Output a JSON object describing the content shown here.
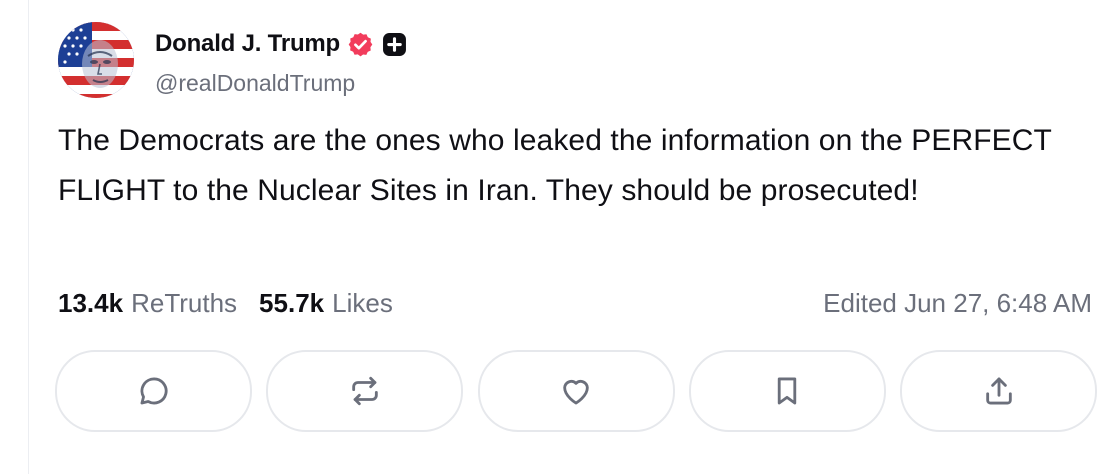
{
  "author": {
    "display_name": "Donald J. Trump",
    "handle": "@realDonaldTrump",
    "verified_icon": "verified-badge-icon",
    "plus_icon": "plus-badge-icon",
    "verified_color": "#f23c5c"
  },
  "post": {
    "text": "The Democrats are the ones who leaked the information on the PERFECT FLIGHT to the Nuclear Sites in Iran. They should be prosecuted!"
  },
  "stats": {
    "retruths_count": "13.4k",
    "retruths_label": "ReTruths",
    "likes_count": "55.7k",
    "likes_label": "Likes",
    "edited": "Edited Jun 27, 6:48 AM"
  },
  "actions": [
    {
      "icon": "reply-icon"
    },
    {
      "icon": "retruth-icon"
    },
    {
      "icon": "like-icon"
    },
    {
      "icon": "bookmark-icon"
    },
    {
      "icon": "share-icon"
    }
  ],
  "colors": {
    "text": "#0f0f14",
    "muted": "#6b6f7b",
    "border": "#e6e8ec"
  }
}
